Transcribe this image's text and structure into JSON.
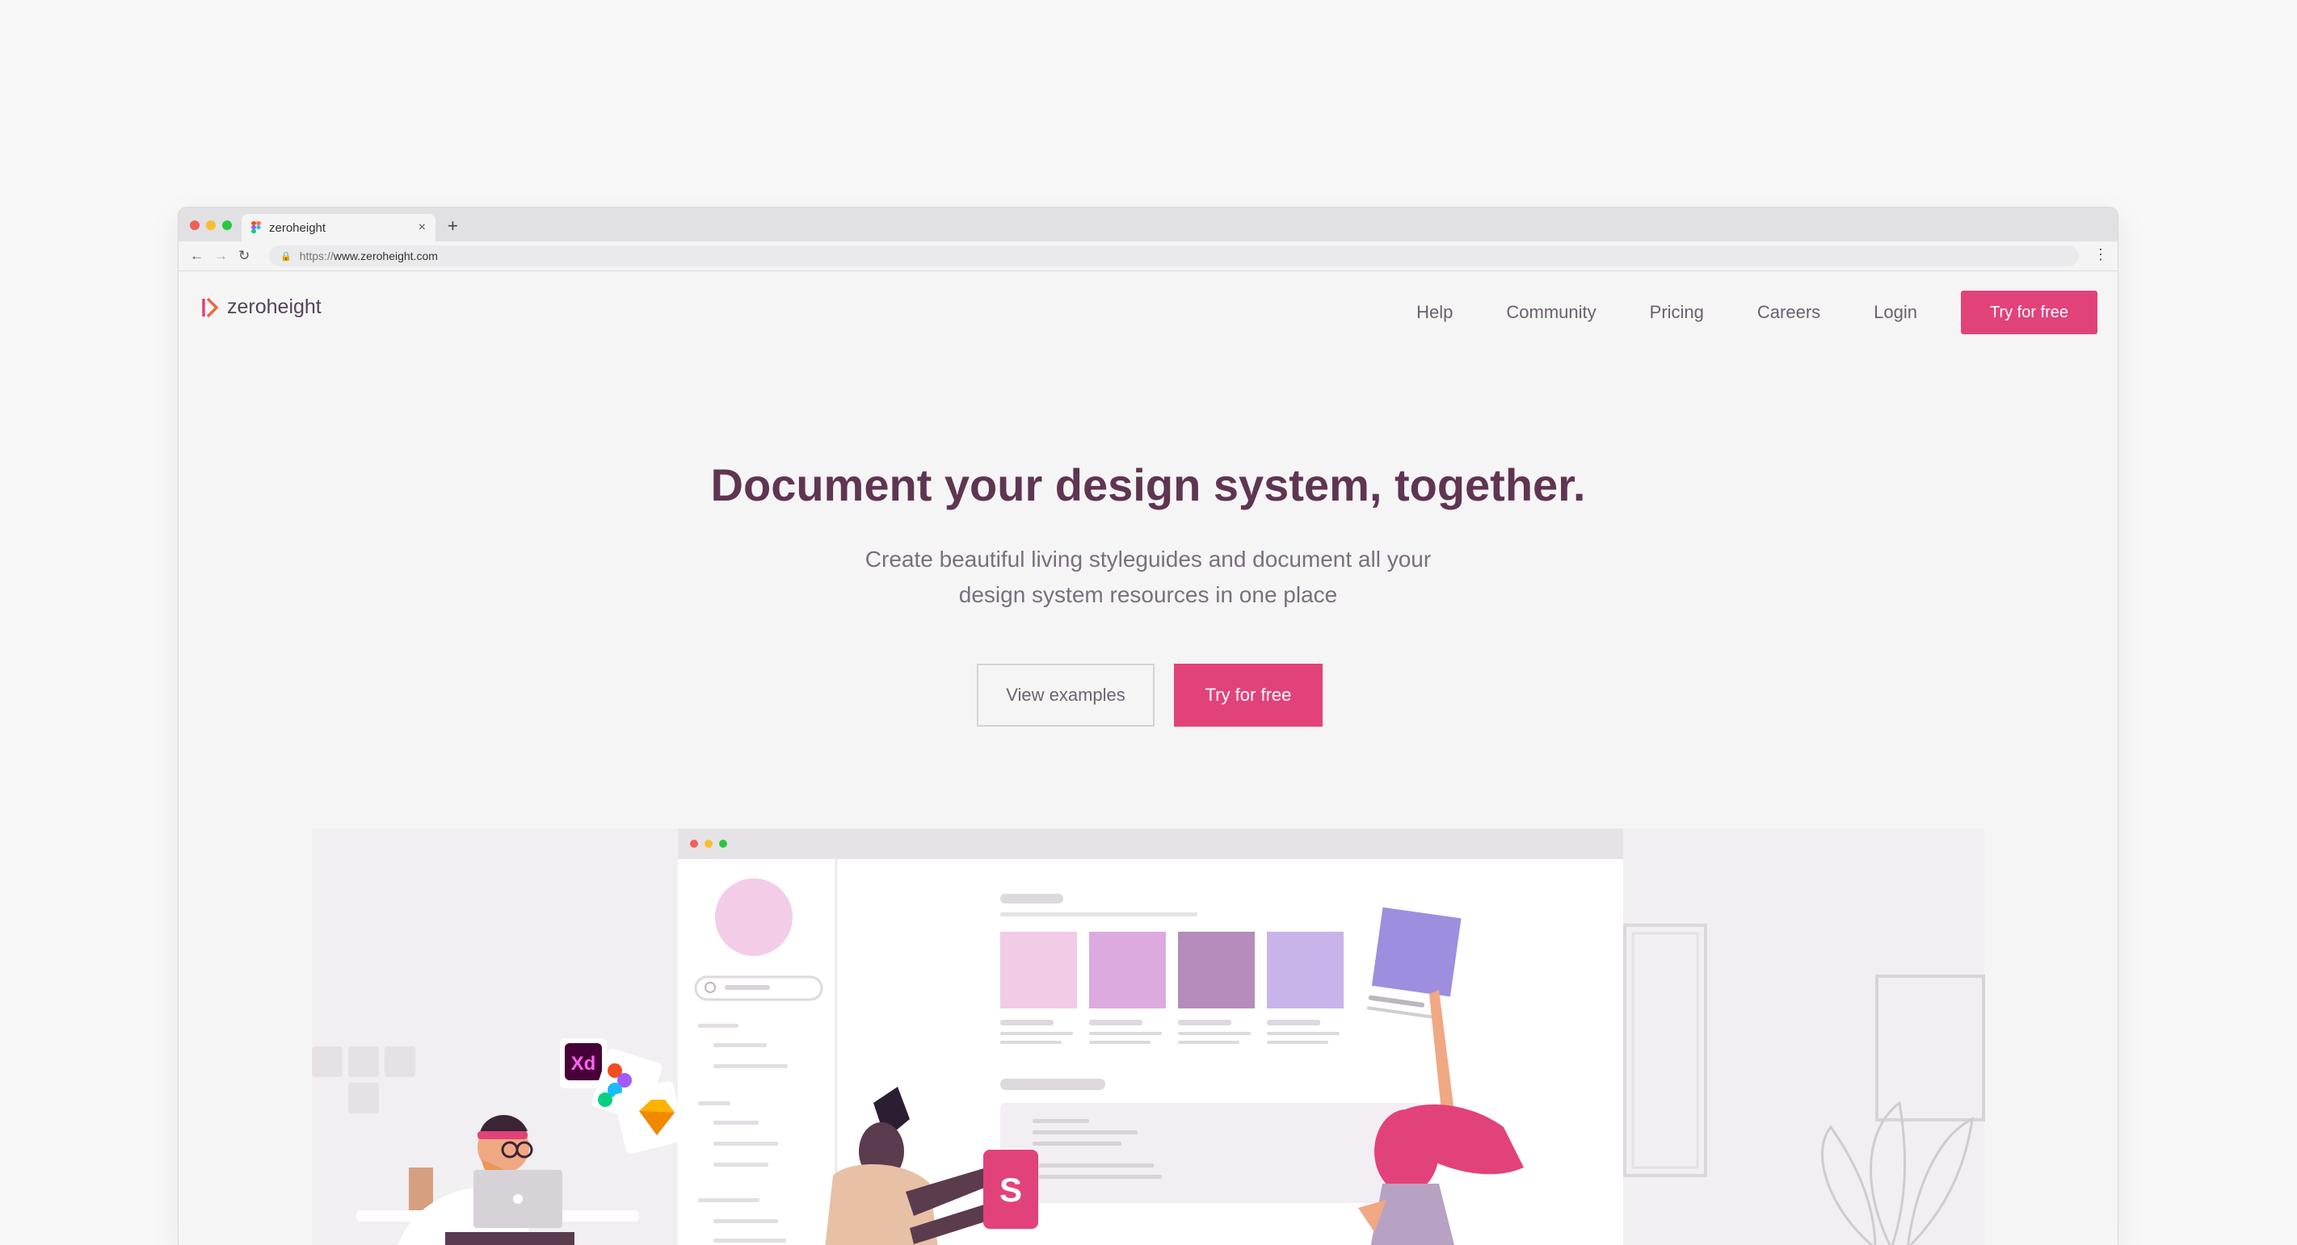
{
  "browser": {
    "tab_title": "zeroheight",
    "new_tab": "+",
    "tab_close": "×",
    "url_protocol": "https://",
    "url_host": "www.zeroheight.com"
  },
  "site": {
    "logo_text": "zeroheight",
    "nav": [
      "Help",
      "Community",
      "Pricing",
      "Careers",
      "Login"
    ],
    "header_cta": "Try for free"
  },
  "hero": {
    "title": "Document your design system, together.",
    "subtitle_line1": "Create beautiful living styleguides and document all your",
    "subtitle_line2": "design system resources in one place",
    "secondary_button": "View examples",
    "primary_button": "Try for free"
  },
  "illustration": {
    "tool_badges": [
      "Xd",
      "S"
    ],
    "swatch_colors": [
      "#f2cbe6",
      "#ddaadf",
      "#b58cbc",
      "#c8b4ea"
    ]
  },
  "colors": {
    "accent": "#e2427a",
    "heading": "#5f3552",
    "text": "#7a6f7e"
  }
}
